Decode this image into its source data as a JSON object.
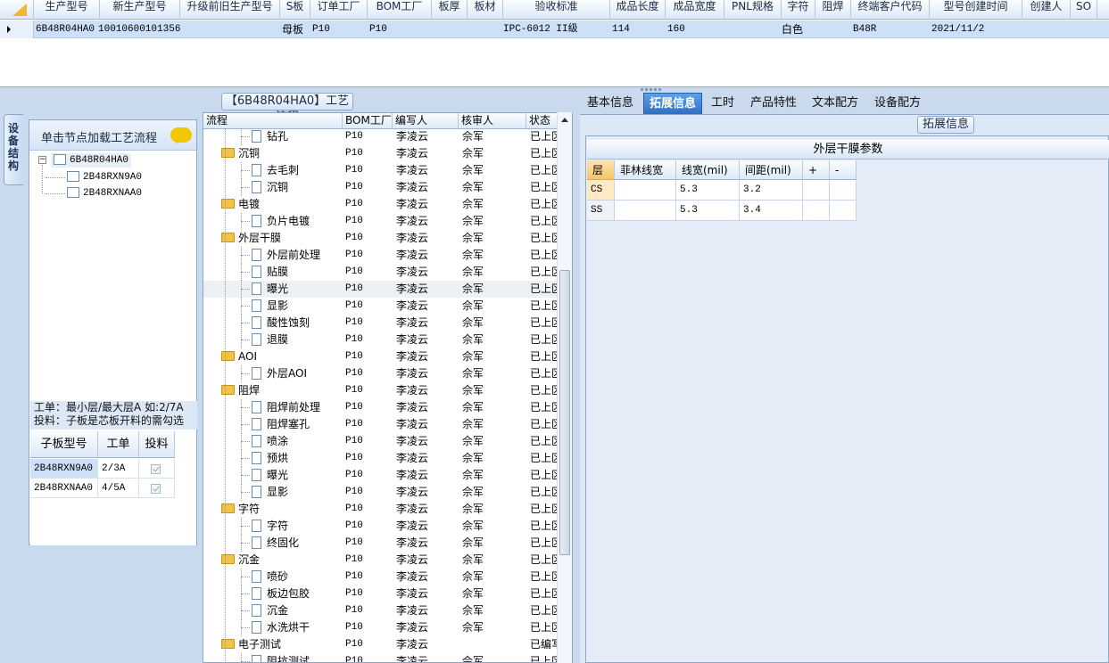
{
  "top_grid": {
    "columns": [
      "生产型号",
      "新生产型号",
      "升级前旧生产型号",
      "S板",
      "订单工厂",
      "BOM工厂",
      "板厚",
      "板材",
      "验收标准",
      "成品长度",
      "成品宽度",
      "PNL规格",
      "字符",
      "阻焊",
      "终端客户代码",
      "型号创建时间",
      "创建人",
      "SO"
    ],
    "row": {
      "prod_model": "6B48R04HA0",
      "new_prod_model": "10010600101356",
      "old_model": "",
      "s_board": "母板",
      "order_factory": "P10",
      "bom_factory": "P10",
      "thickness": "",
      "material": "",
      "standard": "IPC-6012 II级",
      "length": "114",
      "width": "160",
      "pnl": "",
      "char": "白色",
      "mask": "",
      "customer_code": "B48R",
      "created": "2021/11/2",
      "creator": "",
      "so": ""
    }
  },
  "left": {
    "side_tab": "设备结构",
    "panel_title": "单击节点加载工艺流程",
    "tree": {
      "root": "6B48R04HA0",
      "children": [
        "2B48RXN9A0",
        "2B48RXNAA0"
      ]
    },
    "note_line1": "工单：最小层/最大层A 如:2/7A",
    "note_line2": "投料：子板是芯板开料的需勾选",
    "sub_grid": {
      "headers": [
        "子板型号",
        "工单",
        "投料"
      ],
      "rows": [
        {
          "model": "2B48RXN9A0",
          "order": "2/3A"
        },
        {
          "model": "2B48RXNAA0",
          "order": "4/5A"
        }
      ]
    }
  },
  "process": {
    "title": "【6B48R04HA0】工艺流程",
    "headers": [
      "流程",
      "BOM工厂",
      "编写人",
      "核审人",
      "状态"
    ],
    "rows": [
      {
        "name": "钻孔",
        "level": 1,
        "factory": "P10",
        "writer": "李凌云",
        "reviewer": "佘军",
        "status": "已上区"
      },
      {
        "name": "沉铜",
        "level": 0,
        "factory": "P10",
        "writer": "李凌云",
        "reviewer": "佘军",
        "status": "已上区"
      },
      {
        "name": "去毛刺",
        "level": 1,
        "factory": "P10",
        "writer": "李凌云",
        "reviewer": "佘军",
        "status": "已上区"
      },
      {
        "name": "沉铜",
        "level": 1,
        "factory": "P10",
        "writer": "李凌云",
        "reviewer": "佘军",
        "status": "已上区"
      },
      {
        "name": "电镀",
        "level": 0,
        "factory": "P10",
        "writer": "李凌云",
        "reviewer": "佘军",
        "status": "已上区"
      },
      {
        "name": "负片电镀",
        "level": 1,
        "factory": "P10",
        "writer": "李凌云",
        "reviewer": "佘军",
        "status": "已上区"
      },
      {
        "name": "外层干膜",
        "level": 0,
        "factory": "P10",
        "writer": "李凌云",
        "reviewer": "佘军",
        "status": "已上区"
      },
      {
        "name": "外层前处理",
        "level": 1,
        "factory": "P10",
        "writer": "李凌云",
        "reviewer": "佘军",
        "status": "已上区"
      },
      {
        "name": "贴膜",
        "level": 1,
        "factory": "P10",
        "writer": "李凌云",
        "reviewer": "佘军",
        "status": "已上区"
      },
      {
        "name": "曝光",
        "level": 1,
        "factory": "P10",
        "writer": "李凌云",
        "reviewer": "佘军",
        "status": "已上区"
      },
      {
        "name": "显影",
        "level": 1,
        "factory": "P10",
        "writer": "李凌云",
        "reviewer": "佘军",
        "status": "已上区"
      },
      {
        "name": "酸性蚀刻",
        "level": 1,
        "factory": "P10",
        "writer": "李凌云",
        "reviewer": "佘军",
        "status": "已上区"
      },
      {
        "name": "退膜",
        "level": 1,
        "factory": "P10",
        "writer": "李凌云",
        "reviewer": "佘军",
        "status": "已上区"
      },
      {
        "name": "AOI",
        "level": 0,
        "factory": "P10",
        "writer": "李凌云",
        "reviewer": "佘军",
        "status": "已上区"
      },
      {
        "name": "外层AOI",
        "level": 1,
        "factory": "P10",
        "writer": "李凌云",
        "reviewer": "佘军",
        "status": "已上区"
      },
      {
        "name": "阻焊",
        "level": 0,
        "factory": "P10",
        "writer": "李凌云",
        "reviewer": "佘军",
        "status": "已上区"
      },
      {
        "name": "阻焊前处理",
        "level": 1,
        "factory": "P10",
        "writer": "李凌云",
        "reviewer": "佘军",
        "status": "已上区"
      },
      {
        "name": "阻焊塞孔",
        "level": 1,
        "factory": "P10",
        "writer": "李凌云",
        "reviewer": "佘军",
        "status": "已上区"
      },
      {
        "name": "喷涂",
        "level": 1,
        "factory": "P10",
        "writer": "李凌云",
        "reviewer": "佘军",
        "status": "已上区"
      },
      {
        "name": "预烘",
        "level": 1,
        "factory": "P10",
        "writer": "李凌云",
        "reviewer": "佘军",
        "status": "已上区"
      },
      {
        "name": "曝光",
        "level": 1,
        "factory": "P10",
        "writer": "李凌云",
        "reviewer": "佘军",
        "status": "已上区"
      },
      {
        "name": "显影",
        "level": 1,
        "factory": "P10",
        "writer": "李凌云",
        "reviewer": "佘军",
        "status": "已上区"
      },
      {
        "name": "字符",
        "level": 0,
        "factory": "P10",
        "writer": "李凌云",
        "reviewer": "佘军",
        "status": "已上区"
      },
      {
        "name": "字符",
        "level": 1,
        "factory": "P10",
        "writer": "李凌云",
        "reviewer": "佘军",
        "status": "已上区"
      },
      {
        "name": "终固化",
        "level": 1,
        "factory": "P10",
        "writer": "李凌云",
        "reviewer": "佘军",
        "status": "已上区"
      },
      {
        "name": "沉金",
        "level": 0,
        "factory": "P10",
        "writer": "李凌云",
        "reviewer": "佘军",
        "status": "已上区"
      },
      {
        "name": "喷砂",
        "level": 1,
        "factory": "P10",
        "writer": "李凌云",
        "reviewer": "佘军",
        "status": "已上区"
      },
      {
        "name": "板边包胶",
        "level": 1,
        "factory": "P10",
        "writer": "李凌云",
        "reviewer": "佘军",
        "status": "已上区"
      },
      {
        "name": "沉金",
        "level": 1,
        "factory": "P10",
        "writer": "李凌云",
        "reviewer": "佘军",
        "status": "已上区"
      },
      {
        "name": "水洗烘干",
        "level": 1,
        "factory": "P10",
        "writer": "李凌云",
        "reviewer": "佘军",
        "status": "已上区"
      },
      {
        "name": "电子测试",
        "level": 0,
        "factory": "P10",
        "writer": "李凌云",
        "reviewer": "",
        "status": "已编写"
      },
      {
        "name": "阻抗测试",
        "level": 1,
        "factory": "P10",
        "writer": "李凌云",
        "reviewer": "佘军",
        "status": "已上区"
      }
    ]
  },
  "right": {
    "tabs": [
      "基本信息",
      "拓展信息",
      "工时",
      "产品特性",
      "文本配方",
      "设备配方"
    ],
    "active_tab": "拓展信息",
    "section_label": "拓展信息",
    "film": {
      "title": "外层干膜参数",
      "headers": [
        "层",
        "菲林线宽",
        "线宽(mil)",
        "间距(mil)",
        "+",
        "-"
      ],
      "rows": [
        {
          "layer": "CS",
          "film_width": "",
          "line_width": "5.3",
          "spacing": "3.2"
        },
        {
          "layer": "SS",
          "film_width": "",
          "line_width": "5.3",
          "spacing": "3.4"
        }
      ]
    }
  }
}
